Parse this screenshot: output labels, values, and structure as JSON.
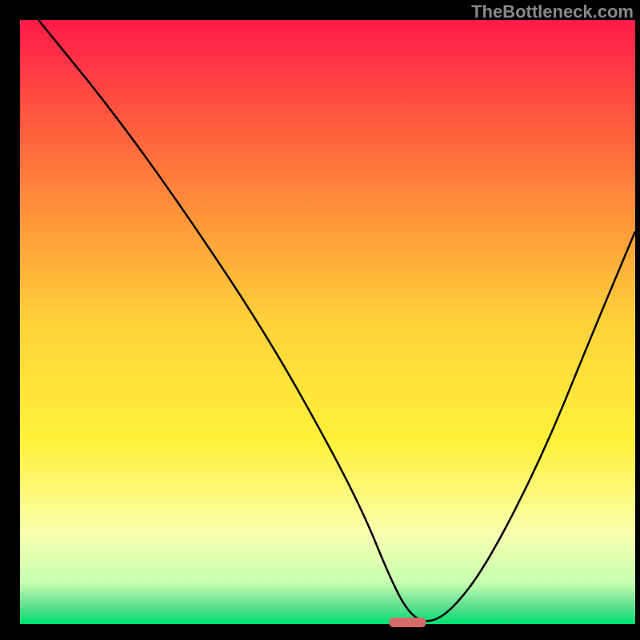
{
  "watermark": "TheBottleneck.com",
  "chart_data": {
    "type": "line",
    "title": "",
    "xlabel": "",
    "ylabel": "",
    "xlim": [
      0,
      100
    ],
    "ylim": [
      0,
      100
    ],
    "grid": false,
    "legend": false,
    "background": {
      "type": "vertical-gradient",
      "stops": [
        {
          "offset": 0,
          "color": "#ff1a4a"
        },
        {
          "offset": 25,
          "color": "#ff7a3a"
        },
        {
          "offset": 50,
          "color": "#ffd23a"
        },
        {
          "offset": 70,
          "color": "#fff23a"
        },
        {
          "offset": 85,
          "color": "#f8ffb0"
        },
        {
          "offset": 93,
          "color": "#c8ffb0"
        },
        {
          "offset": 97,
          "color": "#5fe090"
        },
        {
          "offset": 100,
          "color": "#00e070"
        }
      ]
    },
    "series": [
      {
        "name": "bottleneck-curve",
        "color": "#000000",
        "x": [
          3,
          15,
          27,
          40,
          50,
          56,
          60,
          63,
          66,
          70,
          76,
          85,
          93,
          100
        ],
        "y": [
          100,
          85,
          68,
          48,
          30,
          18,
          8,
          2,
          0,
          2,
          10,
          28,
          48,
          65
        ]
      }
    ],
    "marker": {
      "center_x": 63,
      "y": 0,
      "color": "#d46a6a",
      "width_frac": 0.06
    }
  }
}
